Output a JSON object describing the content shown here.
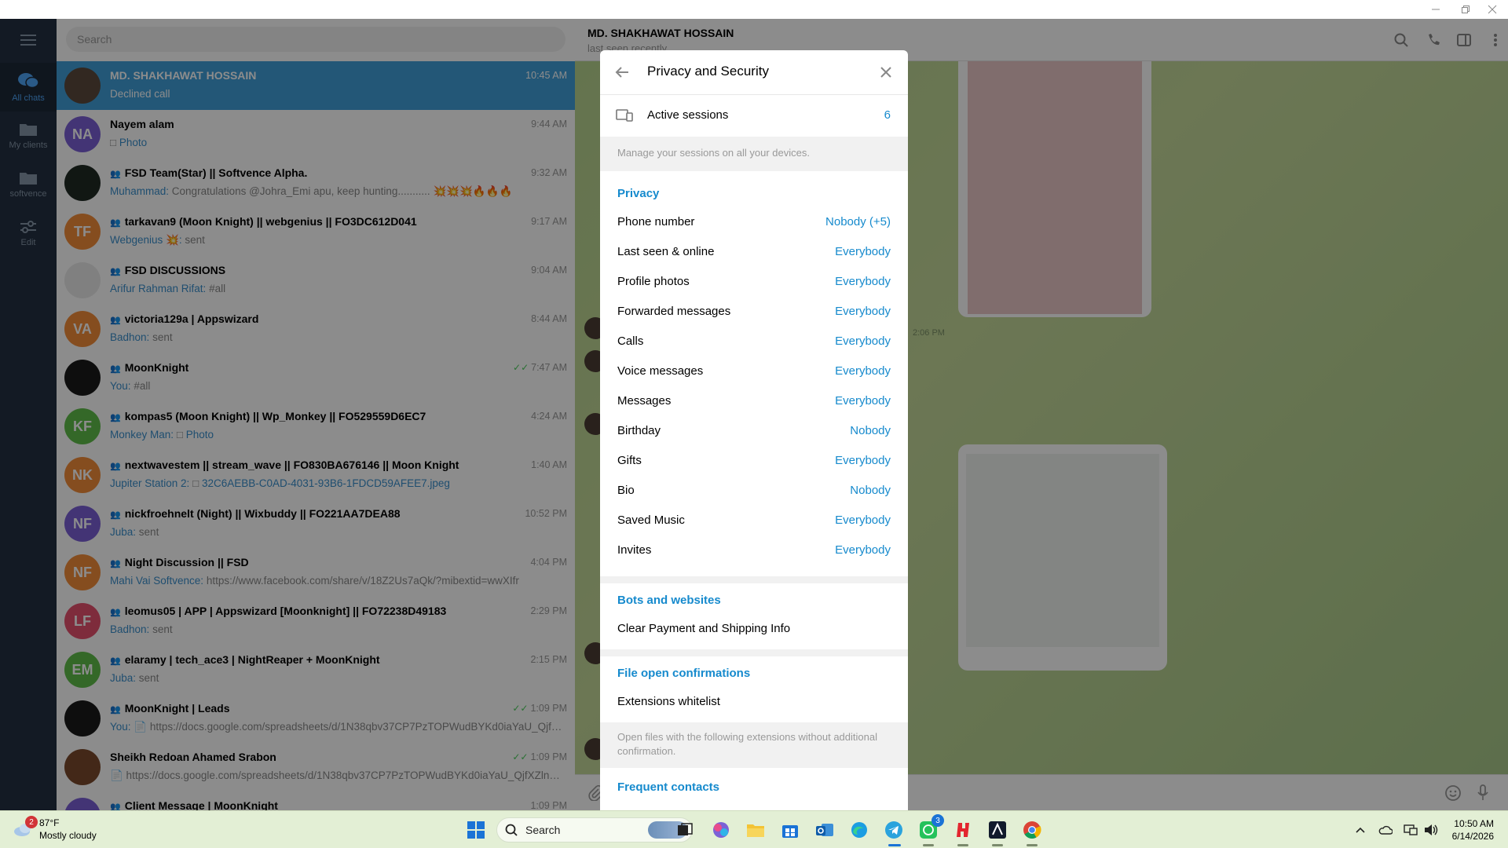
{
  "colors": {
    "rail_bg": "#243143",
    "accent": "#168acd",
    "selected_row": "#419fd9",
    "check_green": "#4dcd5e"
  },
  "rail": {
    "items": [
      {
        "label": "All chats",
        "icon": "chat-bubbles-icon"
      },
      {
        "label": "My clients",
        "icon": "folder-icon"
      },
      {
        "label": "softvence",
        "icon": "folder-icon"
      },
      {
        "label": "Edit",
        "icon": "sliders-icon"
      }
    ]
  },
  "chatlist": {
    "search_placeholder": "Search",
    "chats": [
      {
        "name": "MD. SHAKHAWAT HOSSAIN",
        "time": "10:45 AM",
        "sender": "",
        "message": "Declined call",
        "media": "",
        "initials": "",
        "avatar_color": "#5b4a3c",
        "group": false,
        "read": false
      },
      {
        "name": "Nayem alam",
        "time": "9:44 AM",
        "sender": "",
        "message": "",
        "media": "Photo",
        "initials": "NA",
        "avatar_color": "#7b5fd6",
        "group": false,
        "read": false
      },
      {
        "name": "FSD Team(Star) || Softvence Alpha.",
        "time": "9:32 AM",
        "sender": "Muhammad:",
        "message": "Congratulations @Johra_Emi apu, keep hunting........... 💥💥💥🔥🔥🔥",
        "media": "",
        "initials": "",
        "avatar_color": "#1f2a24",
        "group": true,
        "read": false
      },
      {
        "name": "tarkavan9 (Moon Knight) || webgenius || FO3DC612D041",
        "time": "9:17 AM",
        "sender": "Webgenius 💥:",
        "message": "sent",
        "media": "",
        "initials": "TF",
        "avatar_color": "#f28c3a",
        "group": true,
        "read": false
      },
      {
        "name": "FSD DISCUSSIONS",
        "time": "9:04 AM",
        "sender": "Arifur Rahman Rifat:",
        "message": "#all",
        "media": "",
        "initials": "",
        "avatar_color": "#e9e9e9",
        "group": true,
        "read": false
      },
      {
        "name": "victoria129a | Appswizard",
        "time": "8:44 AM",
        "sender": "Badhon:",
        "message": "sent",
        "media": "",
        "initials": "VA",
        "avatar_color": "#f28c3a",
        "group": true,
        "read": false
      },
      {
        "name": "MoonKnight",
        "time": "7:47 AM",
        "sender": "You:",
        "message": "#all",
        "media": "",
        "initials": "",
        "avatar_color": "#1b1b1b",
        "group": true,
        "read": true
      },
      {
        "name": "kompas5 (Moon Knight) || Wp_Monkey || FO529559D6EC7",
        "time": "4:24 AM",
        "sender": "Monkey Man:",
        "message": "",
        "media": "Photo",
        "initials": "KF",
        "avatar_color": "#5fbd4a",
        "group": true,
        "read": false
      },
      {
        "name": "nextwavestem || stream_wave || FO830BA676146 || Moon Knight",
        "time": "1:40 AM",
        "sender": "Jupiter Station 2:",
        "message": "",
        "media": "32C6AEBB-C0AD-4031-93B6-1FDCD59AFEE7.jpeg",
        "initials": "NK",
        "avatar_color": "#f28c3a",
        "group": true,
        "read": false
      },
      {
        "name": "nickfroehnelt (Night) || Wixbuddy || FO221AA7DEA88",
        "time": "10:52 PM",
        "sender": "Juba:",
        "message": "sent",
        "media": "",
        "initials": "NF",
        "avatar_color": "#7b5fd6",
        "group": true,
        "read": false
      },
      {
        "name": "Night Discussion || FSD",
        "time": "4:04 PM",
        "sender": "Mahi Vai Softvence:",
        "message": "https://www.facebook.com/share/v/18Z2Us7aQk/?mibextid=wwXIfr",
        "media": "",
        "initials": "NF",
        "avatar_color": "#f28c3a",
        "group": true,
        "read": false
      },
      {
        "name": "leomus05 | APP | Appswizard [Moonknight] || FO72238D49183",
        "time": "2:29 PM",
        "sender": "Badhon:",
        "message": "sent",
        "media": "",
        "initials": "LF",
        "avatar_color": "#e5506d",
        "group": true,
        "read": false
      },
      {
        "name": "elaramy | tech_ace3 | NightReaper + MoonKnight",
        "time": "2:15 PM",
        "sender": "Juba:",
        "message": "sent",
        "media": "",
        "initials": "EM",
        "avatar_color": "#5fbd4a",
        "group": true,
        "read": false
      },
      {
        "name": "MoonKnight | Leads",
        "time": "1:09 PM",
        "sender": "You:",
        "message": "📄 https://docs.google.com/spreadsheets/d/1N38qbv37CP7PzTOPWudBYKd0iaYaU_QjfXZl...",
        "media": "",
        "initials": "",
        "avatar_color": "#1b1b1b",
        "group": true,
        "read": true
      },
      {
        "name": "Sheikh Redoan Ahamed Srabon",
        "time": "1:09 PM",
        "sender": "",
        "message": "📄 https://docs.google.com/spreadsheets/d/1N38qbv37CP7PzTOPWudBYKd0iaYaU_QjfXZlnHIw...",
        "media": "",
        "initials": "",
        "avatar_color": "#7a4a2c",
        "group": false,
        "read": true
      },
      {
        "name": "Client Message | MoonKnight",
        "time": "1:09 PM",
        "sender": "",
        "message": "",
        "media": "",
        "initials": "",
        "avatar_color": "#7b5fd6",
        "group": true,
        "read": false
      }
    ]
  },
  "chat": {
    "name": "MD. SHAKHAWAT HOSSAIN",
    "status": "last seen recently",
    "bubble_time": "2:06 PM"
  },
  "modal": {
    "title": "Privacy and Security",
    "active_sessions_label": "Active sessions",
    "active_sessions_count": "6",
    "sessions_note": "Manage your sessions on all your devices.",
    "privacy_header": "Privacy",
    "privacy_rows": [
      {
        "label": "Phone number",
        "value": "Nobody (+5)"
      },
      {
        "label": "Last seen & online",
        "value": "Everybody"
      },
      {
        "label": "Profile photos",
        "value": "Everybody"
      },
      {
        "label": "Forwarded messages",
        "value": "Everybody"
      },
      {
        "label": "Calls",
        "value": "Everybody"
      },
      {
        "label": "Voice messages",
        "value": "Everybody"
      },
      {
        "label": "Messages",
        "value": "Everybody"
      },
      {
        "label": "Birthday",
        "value": "Nobody"
      },
      {
        "label": "Gifts",
        "value": "Everybody"
      },
      {
        "label": "Bio",
        "value": "Nobody"
      },
      {
        "label": "Saved Music",
        "value": "Everybody"
      },
      {
        "label": "Invites",
        "value": "Everybody"
      }
    ],
    "bots_header": "Bots and websites",
    "clear_payment_label": "Clear Payment and Shipping Info",
    "file_header": "File open confirmations",
    "extensions_label": "Extensions whitelist",
    "extensions_note": "Open files with the following extensions without additional confirmation.",
    "frequent_header": "Frequent contacts"
  },
  "taskbar": {
    "weather_badge": "2",
    "weather_temp": "87°F",
    "weather_cond": "Mostly cloudy",
    "search_label": "Search",
    "whatsapp_badge": "3",
    "time": "10:50 AM",
    "date": "6/14/2026"
  }
}
